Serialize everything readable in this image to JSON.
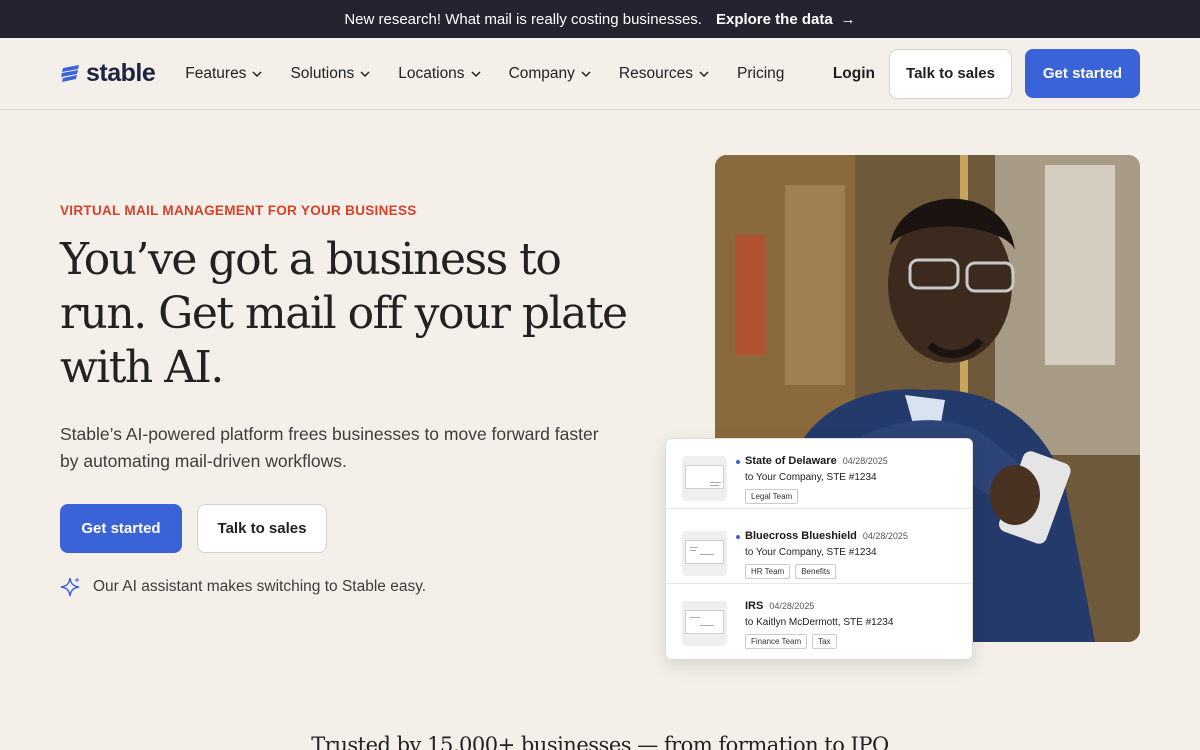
{
  "announcement": {
    "text": "New research! What mail is really costing businesses.",
    "link_label": "Explore the data"
  },
  "nav": {
    "logo_text": "stable",
    "items": [
      {
        "label": "Features",
        "has_dropdown": true
      },
      {
        "label": "Solutions",
        "has_dropdown": true
      },
      {
        "label": "Locations",
        "has_dropdown": true
      },
      {
        "label": "Company",
        "has_dropdown": true
      },
      {
        "label": "Resources",
        "has_dropdown": true
      },
      {
        "label": "Pricing",
        "has_dropdown": false
      }
    ],
    "login_label": "Login",
    "talk_to_sales_label": "Talk to sales",
    "get_started_label": "Get started"
  },
  "hero": {
    "eyebrow": "VIRTUAL MAIL MANAGEMENT FOR YOUR BUSINESS",
    "headline": "You’ve got a business to run. Get mail off your plate with AI.",
    "subtext": "Stable’s AI-powered platform frees businesses to move forward faster by automating mail-driven workflows.",
    "primary_cta": "Get started",
    "secondary_cta": "Talk to sales",
    "ai_note": "Our AI assistant makes switching to Stable easy."
  },
  "mail_items": [
    {
      "sender": "State of Delaware",
      "date": "04/28/2025",
      "to": "to Your Company, STE #1234",
      "tags": [
        "Legal Team"
      ]
    },
    {
      "sender": "Bluecross Blueshield",
      "date": "04/28/2025",
      "to": "to Your Company, STE #1234",
      "tags": [
        "HR Team",
        "Benefits"
      ]
    },
    {
      "sender": "IRS",
      "date": "04/28/2025",
      "to": "to Kaitlyn McDermott, STE #1234",
      "tags": [
        "Finance Team",
        "Tax"
      ]
    }
  ],
  "trusted_text": "Trusted by 15,000+ businesses — from formation to IPO",
  "colors": {
    "accent": "#3a63d8",
    "eyebrow": "#d8402a",
    "announcement_bg": "#23242f",
    "page_bg": "#f4f0e9"
  },
  "icons": {
    "logo": "stable-logo-icon",
    "arrow": "arrow-right-icon",
    "chevron": "chevron-down-icon",
    "sparkle": "sparkle-icon"
  }
}
